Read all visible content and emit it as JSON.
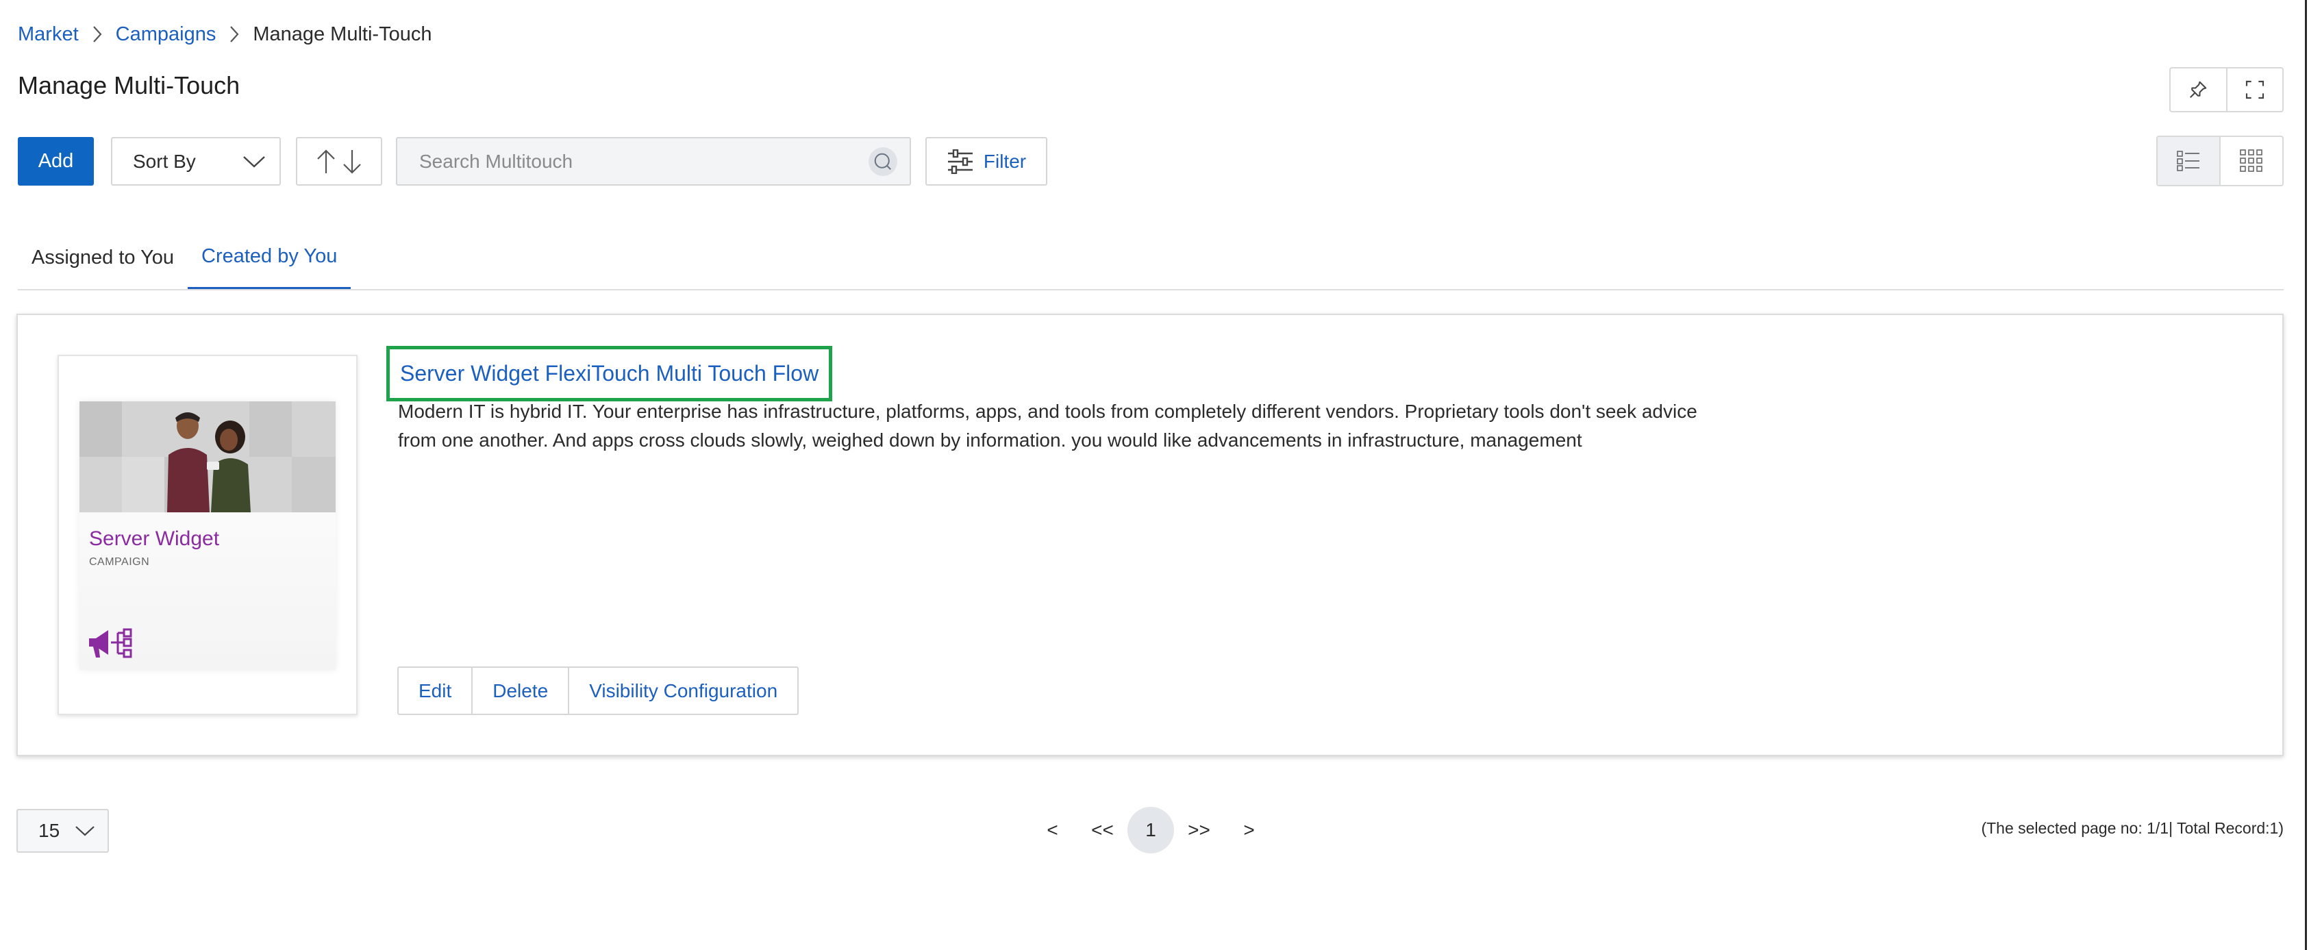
{
  "breadcrumb": {
    "items": [
      "Market",
      "Campaigns"
    ],
    "current": "Manage Multi-Touch"
  },
  "page": {
    "title": "Manage Multi-Touch"
  },
  "toolbar": {
    "add_label": "Add",
    "sort_label": "Sort By",
    "search_placeholder": "Search Multitouch",
    "filter_label": "Filter"
  },
  "tabs": [
    {
      "label": "Assigned to You",
      "active": false
    },
    {
      "label": "Created by You",
      "active": true
    }
  ],
  "card": {
    "thumb_title": "Server Widget",
    "thumb_subtitle": "CAMPAIGN",
    "title": "Server Widget FlexiTouch Multi Touch Flow",
    "description": "Modern IT is hybrid IT. Your enterprise has infrastructure, platforms, apps, and tools from completely different vendors. Proprietary tools don't seek advice from one another. And apps cross clouds slowly, weighed down by information. you would like advancements in infrastructure, management",
    "actions": [
      "Edit",
      "Delete",
      "Visibility Configuration"
    ]
  },
  "pagination": {
    "page_size": "15",
    "prev": "<",
    "first": "<<",
    "current": "1",
    "last": ">>",
    "next": ">",
    "info": "(The selected page no: 1/1| Total Record:1)"
  },
  "colors": {
    "accent": "#0f66c2",
    "link": "#1b5fbf",
    "highlight": "#1fa34a",
    "brand_purple": "#8a2ba0"
  }
}
